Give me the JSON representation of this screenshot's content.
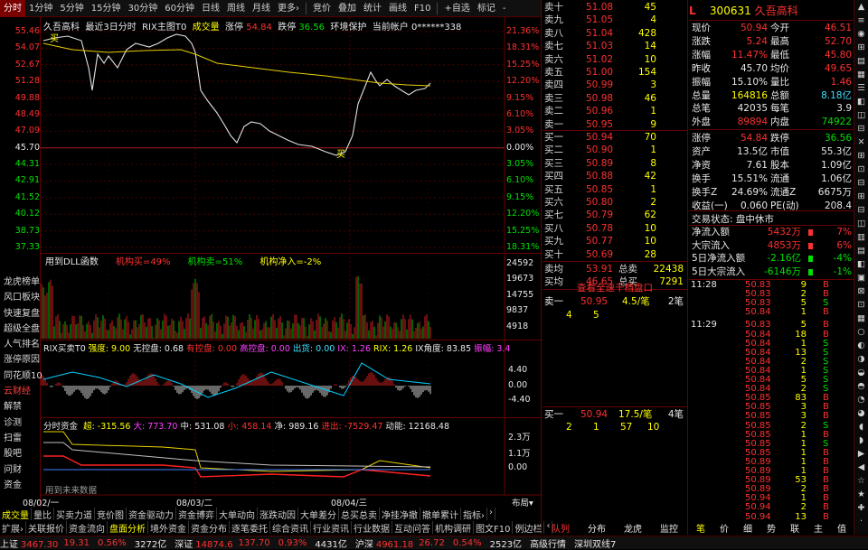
{
  "toolbar": {
    "items": [
      "分时",
      "1分钟",
      "5分钟",
      "15分钟",
      "30分钟",
      "60分钟",
      "日线",
      "周线",
      "月线",
      "更多›",
      "竞价",
      "叠加",
      "统计",
      "画线",
      "F10",
      "+自选",
      "标记",
      "-"
    ],
    "active": 0
  },
  "chart": {
    "info": {
      "name": "久吾高科",
      "subtitle": "最近3日分时",
      "rix": "RIX主图T0",
      "vol": "成交量",
      "zhangting_label": "涨停",
      "zhangting": "54.84",
      "dieting_label": "跌停",
      "dieting": "36.56",
      "env": "环境保护",
      "account_label": "当前帐户",
      "account": "0******338"
    },
    "price_ticks": [
      "55.46",
      "54.07",
      "52.67",
      "51.28",
      "49.88",
      "48.49",
      "47.09",
      "45.70",
      "44.31",
      "42.91",
      "41.52",
      "40.12",
      "38.73",
      "37.33"
    ],
    "pct_ticks": [
      "21.36%",
      "18.31%",
      "15.25%",
      "12.20%",
      "9.15%",
      "6.10%",
      "3.05%",
      "0.00%",
      "3.05%",
      "6.10%",
      "9.15%",
      "12.20%",
      "15.25%",
      "18.31%"
    ],
    "marker_label": "买",
    "dll": {
      "title": "用到DLL函数",
      "a_label": "机构买",
      "a": "49%",
      "b_label": "机构卖",
      "b": "51%",
      "c_label": "机构净入",
      "c": "-2%"
    },
    "vol_ticks": [
      "24592",
      "19673",
      "14755",
      "9837",
      "4918"
    ],
    "rix": {
      "title": "RIX买卖T0",
      "s1": "强度: 9.00",
      "s2": "无控盘: 0.68",
      "s3": "有控盘: 0.00",
      "s4": "高控盘: 0.00",
      "s5": "出货: 0.00",
      "s6": "IX: 1.26",
      "s7": "RIX: 1.26",
      "s8": "IX角度: 83.85",
      "s9": "振幅: 3.4",
      "ticks": [
        "4.40",
        "0.00",
        "-4.40"
      ]
    },
    "flow": {
      "title": "分时资金",
      "s1": "超: -315.56",
      "s2": "大: 773.70",
      "s3": "中: 531.08",
      "s4": "小: 458.14",
      "s5": "净: 989.16",
      "s6": "进出: -7529.47",
      "s7": "动能: 12168.48",
      "ticks": [
        "2.3万",
        "1.1万",
        "0.00"
      ],
      "note": "用到未来数据"
    },
    "dates": [
      "08/02/一",
      "08/03/二",
      "08/04/三"
    ],
    "layout_label": "布局▾"
  },
  "sidebar": [
    "龙虎榜单",
    "风口板块",
    "快速复盘",
    "超级全盘",
    "人气排名",
    "涨停原因",
    "同花顺10",
    "云财经",
    "解禁",
    "诊测",
    "扫雷",
    "股吧",
    "问财",
    "资金"
  ],
  "sidebar_active": 7,
  "bottom_tabs_1": [
    "成交量",
    "量比",
    "买卖力道",
    "竞价图",
    "资金驱动力",
    "资金博弈",
    "大单动向",
    "涨跌动因",
    "大单差分",
    "总买总卖",
    "净挂净撤",
    "撤单累计",
    "指标›",
    "›"
  ],
  "bottom_tabs_2": [
    "扩展›",
    "关联报价",
    "资金流向",
    "盘面分析",
    "境外资金",
    "资金分布",
    "逐笔委托",
    "综合资讯",
    "行业资讯",
    "行业数据",
    "互动问答",
    "机构调研",
    "图文F10",
    "例边栏",
    "‹"
  ],
  "orderbook": {
    "asks": [
      [
        "卖十",
        "51.08",
        "45"
      ],
      [
        "卖九",
        "51.05",
        "4"
      ],
      [
        "卖八",
        "51.04",
        "428"
      ],
      [
        "卖七",
        "51.03",
        "14"
      ],
      [
        "卖六",
        "51.02",
        "10"
      ],
      [
        "卖五",
        "51.00",
        "154"
      ],
      [
        "卖四",
        "50.99",
        "3"
      ],
      [
        "卖三",
        "50.98",
        "46"
      ],
      [
        "卖二",
        "50.96",
        "1"
      ],
      [
        "卖一",
        "50.95",
        "9"
      ]
    ],
    "bids": [
      [
        "买一",
        "50.94",
        "70"
      ],
      [
        "买二",
        "50.90",
        "1"
      ],
      [
        "买三",
        "50.89",
        "8"
      ],
      [
        "买四",
        "50.88",
        "42"
      ],
      [
        "买五",
        "50.85",
        "1"
      ],
      [
        "买六",
        "50.80",
        "2"
      ],
      [
        "买七",
        "50.79",
        "62"
      ],
      [
        "买八",
        "50.78",
        "10"
      ],
      [
        "买九",
        "50.77",
        "10"
      ],
      [
        "买十",
        "50.69",
        "28"
      ]
    ],
    "avg_sell_label": "卖均",
    "avg_sell": "53.91",
    "total_sell_label": "总卖",
    "total_sell": "22438",
    "avg_buy_label": "买均",
    "avg_buy": "46.65",
    "total_buy_label": "总买",
    "total_buy": "7291",
    "link": "查看全速千档盘口",
    "q_ask": {
      "label": "卖一",
      "price": "50.95",
      "qty": "4.5/笔",
      "n": "2笔",
      "d1": "4",
      "d2": "5"
    },
    "q_bid": {
      "label": "买一",
      "price": "50.94",
      "qty": "17.5/笔",
      "n": "4笔",
      "d1": "2",
      "d2": "1",
      "d3": "57",
      "d4": "10"
    }
  },
  "quote": {
    "header": {
      "flag": "L",
      "code": "300631",
      "name": "久吾高科"
    },
    "rows": [
      [
        [
          "现价",
          "50.94",
          "red"
        ],
        [
          "今开",
          "46.51",
          "red"
        ]
      ],
      [
        [
          "涨跌",
          "5.24",
          "red"
        ],
        [
          "最高",
          "52.70",
          "red"
        ]
      ],
      [
        [
          "涨幅",
          "11.47%",
          "red"
        ],
        [
          "最低",
          "45.80",
          "red"
        ]
      ],
      [
        [
          "昨收",
          "45.70",
          "wht"
        ],
        [
          "均价",
          "49.65",
          "red"
        ]
      ],
      [
        [
          "振幅",
          "15.10%",
          "wht"
        ],
        [
          "量比",
          "1.46",
          "red"
        ]
      ],
      [
        [
          "总量",
          "164816",
          "yel"
        ],
        [
          "总额",
          "8.18亿",
          "cyn"
        ]
      ],
      [
        [
          "总笔",
          "42035",
          "wht"
        ],
        [
          "每笔",
          "3.9",
          "wht"
        ]
      ],
      [
        [
          "外盘",
          "89894",
          "red"
        ],
        [
          "内盘",
          "74922",
          "grn"
        ]
      ],
      [
        [
          "涨停",
          "54.84",
          "red"
        ],
        [
          "跌停",
          "36.56",
          "grn"
        ]
      ],
      [
        [
          "资产",
          "13.5亿",
          "wht"
        ],
        [
          "市值",
          "55.3亿",
          "wht"
        ]
      ],
      [
        [
          "净资",
          "7.61",
          "wht"
        ],
        [
          "股本",
          "1.09亿",
          "wht"
        ]
      ],
      [
        [
          "换手",
          "15.51%",
          "wht"
        ],
        [
          "流通",
          "1.06亿",
          "wht"
        ]
      ],
      [
        [
          "换手Z",
          "24.69%",
          "wht"
        ],
        [
          "流通Z",
          "6675万",
          "wht"
        ]
      ],
      [
        [
          "收益(一)",
          "0.060",
          "wht"
        ],
        [
          "PE(动)",
          "208.4",
          "wht"
        ]
      ]
    ],
    "trade_status": "交易状态: 盘中休市",
    "flows": [
      [
        "净流入额",
        "5432万",
        "7%",
        "red"
      ],
      [
        "大宗流入",
        "4853万",
        "6%",
        "red"
      ],
      [
        "5日净流入额",
        "-2.16亿",
        "-4%",
        "grn"
      ],
      [
        "5日大宗流入",
        "-6146万",
        "-1%",
        "grn"
      ]
    ]
  },
  "ticks": {
    "times": [
      "11:28",
      "11:29"
    ],
    "rows": [
      [
        "11:28",
        "50.83",
        "9",
        "B"
      ],
      [
        "",
        "50.83",
        "2",
        "B"
      ],
      [
        "",
        "50.83",
        "5",
        "S"
      ],
      [
        "",
        "50.84",
        "1",
        "B"
      ],
      [
        "11:29",
        "50.83",
        "5",
        "B"
      ],
      [
        "",
        "50.84",
        "18",
        "B"
      ],
      [
        "",
        "50.84",
        "1",
        "S"
      ],
      [
        "",
        "50.84",
        "13",
        "S"
      ],
      [
        "",
        "50.84",
        "2",
        "S"
      ],
      [
        "",
        "50.84",
        "1",
        "S"
      ],
      [
        "",
        "50.84",
        "5",
        "S"
      ],
      [
        "",
        "50.84",
        "2",
        "S"
      ],
      [
        "",
        "50.85",
        "83",
        "B"
      ],
      [
        "",
        "50.85",
        "3",
        "B"
      ],
      [
        "",
        "50.85",
        "3",
        "B"
      ],
      [
        "",
        "50.85",
        "2",
        "S"
      ],
      [
        "",
        "50.85",
        "1",
        "B"
      ],
      [
        "",
        "50.85",
        "1",
        "S"
      ],
      [
        "",
        "50.85",
        "1",
        "B"
      ],
      [
        "",
        "50.89",
        "1",
        "B"
      ],
      [
        "",
        "50.89",
        "1",
        "B"
      ],
      [
        "",
        "50.89",
        "53",
        "B"
      ],
      [
        "",
        "50.89",
        "2",
        "B"
      ],
      [
        "",
        "50.94",
        "1",
        "B"
      ],
      [
        "",
        "50.94",
        "2",
        "B"
      ],
      [
        "",
        "50.94",
        "13",
        "B"
      ]
    ]
  },
  "mid_tabs": [
    "队列",
    "分布",
    "龙虎",
    "监控"
  ],
  "right_tabs": [
    "笔",
    "价",
    "细",
    "势",
    "联",
    "主",
    "值"
  ],
  "right_icons": [
    "▲",
    "≡",
    "◉",
    "⊞",
    "▤",
    "▦",
    "☰",
    "◧",
    "◫",
    "⊟",
    "✕",
    "⊞",
    "⊡",
    "⊟",
    "⊞",
    "⊟",
    "◫",
    "▥",
    "▤",
    "◧",
    "▣",
    "⊠",
    "⊡",
    "▦",
    "○",
    "◐",
    "◑",
    "◒",
    "◓",
    "◔",
    "◕",
    "◖",
    "◗",
    "▶",
    "◀",
    "☆",
    "★",
    "✚",
    "·",
    "·",
    "⊙",
    "⊙",
    "⊙",
    "⊙",
    "⊙",
    "⊙",
    "⊙",
    "⊙",
    "✓",
    "⊕",
    "⊖",
    "全",
    "部",
    "分",
    "季",
    "年",
    "⋮",
    "⊕",
    "?"
  ],
  "status": {
    "items": [
      [
        "上证",
        "3467.30",
        "red"
      ],
      [
        "19.31",
        "",
        "red"
      ],
      [
        "0.56%",
        "",
        "red"
      ],
      [
        "3272亿",
        "",
        "wht"
      ],
      [
        "深证",
        "14874.6",
        "red"
      ],
      [
        "137.70",
        "",
        "red"
      ],
      [
        "0.93%",
        "",
        "red"
      ],
      [
        "4431亿",
        "",
        "wht"
      ],
      [
        "沪深",
        "4961.18",
        "red"
      ],
      [
        "26.72",
        "",
        "red"
      ],
      [
        "0.54%",
        "",
        "red"
      ],
      [
        "2523亿",
        "",
        "wht"
      ],
      [
        "高级行情",
        "",
        "wht"
      ],
      [
        "深圳双线7",
        "",
        "wht"
      ]
    ]
  }
}
